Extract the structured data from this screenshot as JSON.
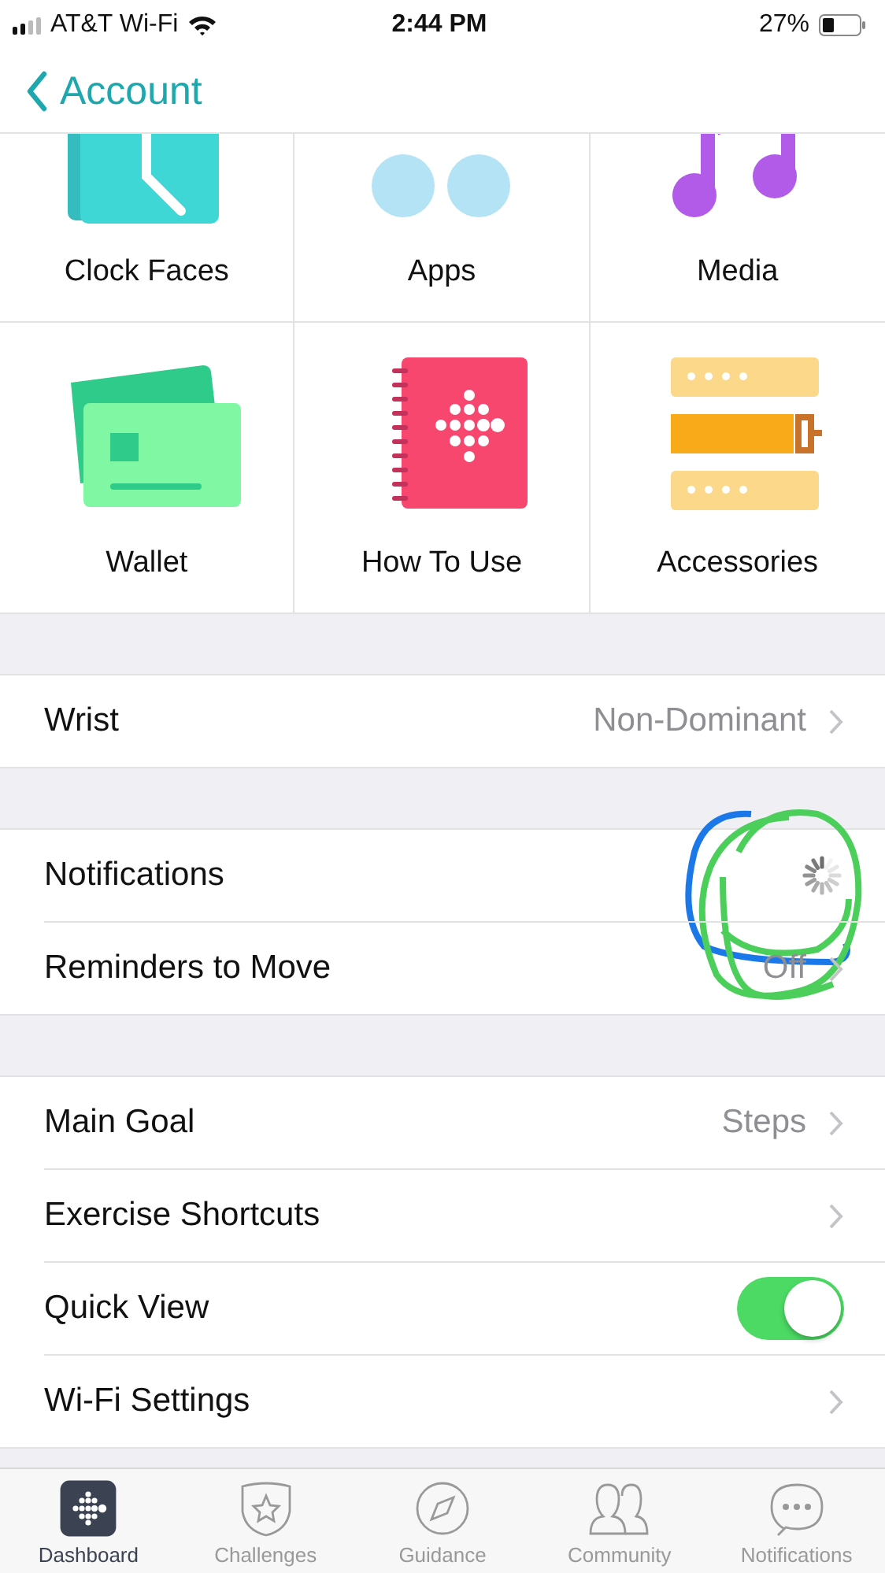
{
  "status_bar": {
    "carrier": "AT&T Wi-Fi",
    "time": "2:44 PM",
    "battery": "27%"
  },
  "nav": {
    "back": "Account"
  },
  "tiles": [
    {
      "label": "Clock Faces",
      "kind": "clock"
    },
    {
      "label": "Apps",
      "kind": "apps"
    },
    {
      "label": "Media",
      "kind": "media"
    },
    {
      "label": "Wallet",
      "kind": "wallet"
    },
    {
      "label": "How To Use",
      "kind": "guide"
    },
    {
      "label": "Accessories",
      "kind": "band"
    }
  ],
  "sections": [
    {
      "rows": [
        {
          "label": "Wrist",
          "value": "Non-Dominant",
          "kind": "link"
        }
      ]
    },
    {
      "annotated": true,
      "rows": [
        {
          "label": "Notifications",
          "kind": "loading"
        },
        {
          "label": "Reminders to Move",
          "value": "Off",
          "kind": "link"
        }
      ]
    },
    {
      "rows": [
        {
          "label": "Main Goal",
          "value": "Steps",
          "kind": "link"
        },
        {
          "label": "Exercise Shortcuts",
          "kind": "link"
        },
        {
          "label": "Quick View",
          "kind": "toggle",
          "on": true
        },
        {
          "label": "Wi-Fi Settings",
          "kind": "link"
        }
      ]
    }
  ],
  "tab_bar": [
    {
      "label": "Dashboard",
      "kind": "dashboard",
      "selected": true
    },
    {
      "label": "Challenges",
      "kind": "challenges",
      "selected": false
    },
    {
      "label": "Guidance",
      "kind": "guidance",
      "selected": false
    },
    {
      "label": "Community",
      "kind": "community",
      "selected": false
    },
    {
      "label": "Notifications",
      "kind": "notifications",
      "selected": false
    }
  ]
}
